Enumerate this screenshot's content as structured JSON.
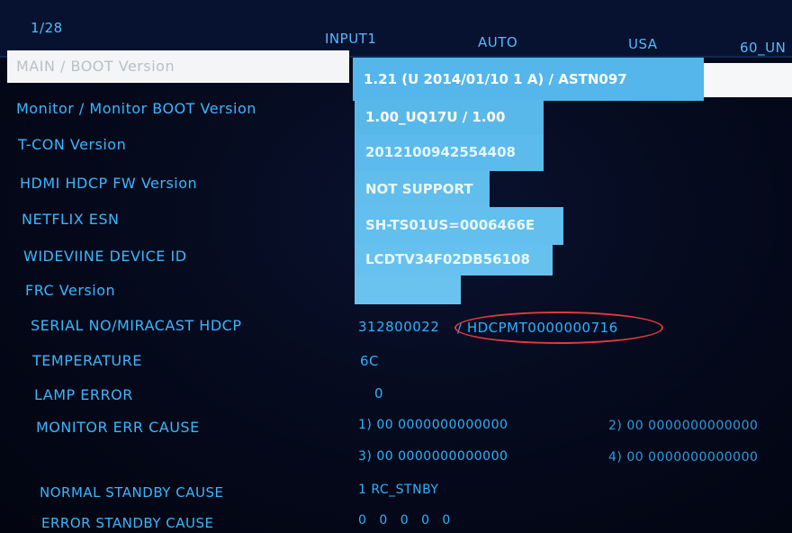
{
  "header": {
    "page": "1/28",
    "input": "INPUT1",
    "mode": "AUTO",
    "region": "USA",
    "model": "60_UN"
  },
  "rows": {
    "main_boot": {
      "label": "MAIN / BOOT Version",
      "value": "1.21 (U 2014/01/10 1 A) / ASTN097"
    },
    "monitor_boot": {
      "label": "Monitor / Monitor BOOT Version",
      "value": "1.00_UQ17U / 1.00"
    },
    "tcon": {
      "label": "T-CON Version",
      "value": "2012100942554408"
    },
    "hdmi_hdcp": {
      "label": "HDMI HDCP FW Version",
      "value": "NOT SUPPORT"
    },
    "netflix": {
      "label": "NETFLIX ESN",
      "value": "SH-TS01US=0006466E"
    },
    "widevine": {
      "label": "WIDEVIINE DEVICE ID",
      "value": "LCDTV34F02DB56108"
    },
    "frc": {
      "label": "FRC Version",
      "value": ""
    },
    "serial": {
      "label": "SERIAL NO/MIRACAST HDCP",
      "value_serial": "312800022",
      "value_hdcp": "/ HDCPMT0000000716"
    },
    "temperature": {
      "label": "TEMPERATURE",
      "value": "6C"
    },
    "lamp_error": {
      "label": "LAMP ERROR",
      "value": "0"
    },
    "monitor_err": {
      "label": "MONITOR ERR CAUSE",
      "values": [
        "1) 00 0000000000000",
        "2) 00 0000000000000",
        "3) 00 0000000000000",
        "4) 00 0000000000000"
      ]
    },
    "normal_standby": {
      "label": "NORMAL STANDBY CAUSE",
      "value": "1 RC_STNBY"
    },
    "error_standby": {
      "label": "ERROR STANDBY CAUSE",
      "value": "0 0 0 0 0"
    }
  },
  "colors": {
    "text": "#3fb8ff",
    "selection": "#f3f5f7",
    "value_panel": "#54b6ea",
    "annotation": "#e23a3a"
  }
}
